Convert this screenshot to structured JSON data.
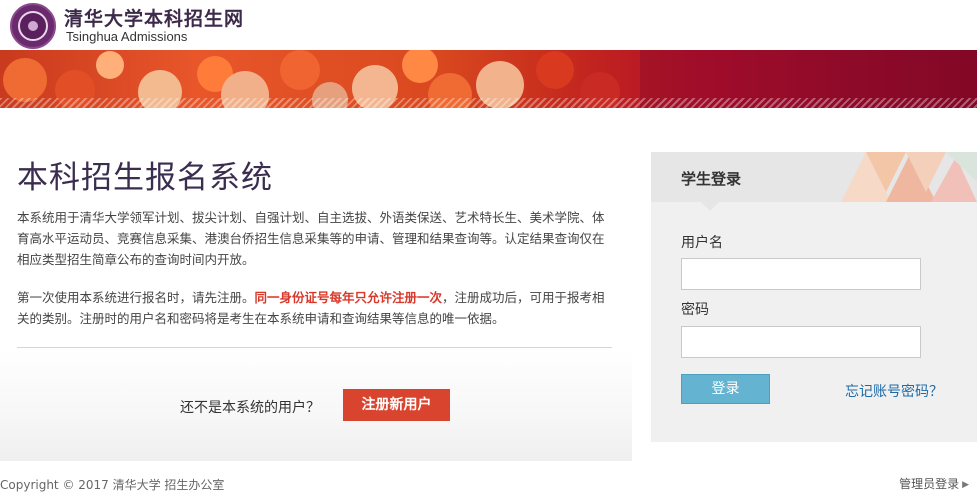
{
  "header": {
    "logo_icon": "tsinghua-seal-icon",
    "brand_cn": "清华大学本科招生网",
    "brand_en": "Tsinghua Admissions"
  },
  "main": {
    "title": "本科招生报名系统",
    "intro": "本系统用于清华大学领军计划、拔尖计划、自强计划、自主选拔、外语类保送、艺术特长生、美术学院、体育高水平运动员、竞赛信息采集、港澳台侨招生信息采集等的申请、管理和结果查询等。认定结果查询仅在相应类型招生简章公布的查询时间内开放。",
    "note_before": "第一次使用本系统进行报名时，请先注册。",
    "note_emphasis": "同一身份证号每年只允许注册一次",
    "note_after": "，注册成功后，可用于报考相关的类别。注册时的用户名和密码将是考生在本系统申请和查询结果等信息的唯一依据。",
    "not_user_text": "还不是本系统的用户？",
    "register_label": "注册新用户"
  },
  "login": {
    "title": "学生登录",
    "username_label": "用户名",
    "username_value": "",
    "password_label": "密码",
    "password_value": "",
    "submit_label": "登录",
    "forgot_label": "忘记账号密码？"
  },
  "footer": {
    "copyright": "Copyright © 2017 清华大学  招生办公室",
    "admin_login": "管理员登录"
  },
  "colors": {
    "brand_purple": "#3d2a4a",
    "register_red": "#d9442f",
    "login_blue": "#64b3d1",
    "link_blue": "#1d6aa8"
  }
}
